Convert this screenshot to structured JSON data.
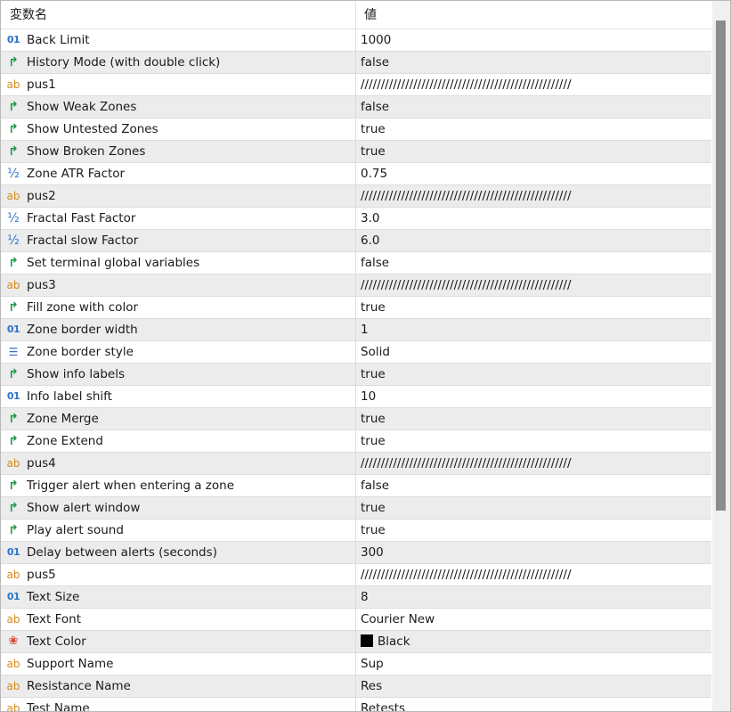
{
  "header": {
    "name_label": "変数名",
    "value_label": "値"
  },
  "rows": [
    {
      "icon": "int-icon",
      "glyph": "01",
      "kind": "int",
      "name": "Back Limit",
      "value": "1000"
    },
    {
      "icon": "bool-icon",
      "glyph": "↱",
      "kind": "bool",
      "name": "History Mode (with double click)",
      "value": "false"
    },
    {
      "icon": "string-icon",
      "glyph": "ab",
      "kind": "str",
      "name": "pus1",
      "value": "////////////////////////////////////////////////////"
    },
    {
      "icon": "bool-icon",
      "glyph": "↱",
      "kind": "bool",
      "name": "Show Weak Zones",
      "value": "false"
    },
    {
      "icon": "bool-icon",
      "glyph": "↱",
      "kind": "bool",
      "name": "Show Untested Zones",
      "value": "true"
    },
    {
      "icon": "bool-icon",
      "glyph": "↱",
      "kind": "bool",
      "name": "Show Broken Zones",
      "value": "true"
    },
    {
      "icon": "double-icon",
      "glyph": "½",
      "kind": "dbl",
      "name": "Zone ATR Factor",
      "value": "0.75"
    },
    {
      "icon": "string-icon",
      "glyph": "ab",
      "kind": "str",
      "name": "pus2",
      "value": "////////////////////////////////////////////////////"
    },
    {
      "icon": "double-icon",
      "glyph": "½",
      "kind": "dbl",
      "name": "Fractal Fast Factor",
      "value": "3.0"
    },
    {
      "icon": "double-icon",
      "glyph": "½",
      "kind": "dbl",
      "name": "Fractal slow Factor",
      "value": "6.0"
    },
    {
      "icon": "bool-icon",
      "glyph": "↱",
      "kind": "bool",
      "name": "Set terminal global variables",
      "value": "false"
    },
    {
      "icon": "string-icon",
      "glyph": "ab",
      "kind": "str",
      "name": "pus3",
      "value": "////////////////////////////////////////////////////"
    },
    {
      "icon": "bool-icon",
      "glyph": "↱",
      "kind": "bool",
      "name": "Fill zone with color",
      "value": "true"
    },
    {
      "icon": "int-icon",
      "glyph": "01",
      "kind": "int",
      "name": "Zone border width",
      "value": "1"
    },
    {
      "icon": "enum-icon",
      "glyph": "☰",
      "kind": "enum",
      "name": "Zone border style",
      "value": "Solid"
    },
    {
      "icon": "bool-icon",
      "glyph": "↱",
      "kind": "bool",
      "name": "Show info labels",
      "value": "true"
    },
    {
      "icon": "int-icon",
      "glyph": "01",
      "kind": "int",
      "name": "Info label shift",
      "value": "10"
    },
    {
      "icon": "bool-icon",
      "glyph": "↱",
      "kind": "bool",
      "name": "Zone Merge",
      "value": "true"
    },
    {
      "icon": "bool-icon",
      "glyph": "↱",
      "kind": "bool",
      "name": "Zone Extend",
      "value": "true"
    },
    {
      "icon": "string-icon",
      "glyph": "ab",
      "kind": "str",
      "name": "pus4",
      "value": "////////////////////////////////////////////////////"
    },
    {
      "icon": "bool-icon",
      "glyph": "↱",
      "kind": "bool",
      "name": "Trigger alert when entering a zone",
      "value": "false"
    },
    {
      "icon": "bool-icon",
      "glyph": "↱",
      "kind": "bool",
      "name": "Show alert window",
      "value": "true"
    },
    {
      "icon": "bool-icon",
      "glyph": "↱",
      "kind": "bool",
      "name": "Play alert sound",
      "value": "true"
    },
    {
      "icon": "int-icon",
      "glyph": "01",
      "kind": "int",
      "name": "Delay between alerts (seconds)",
      "value": "300"
    },
    {
      "icon": "string-icon",
      "glyph": "ab",
      "kind": "str",
      "name": "pus5",
      "value": "////////////////////////////////////////////////////"
    },
    {
      "icon": "int-icon",
      "glyph": "01",
      "kind": "int",
      "name": "Text Size",
      "value": "8"
    },
    {
      "icon": "string-icon",
      "glyph": "ab",
      "kind": "str",
      "name": "Text Font",
      "value": "Courier New"
    },
    {
      "icon": "color-icon",
      "glyph": "❀",
      "kind": "clr",
      "name": "Text Color",
      "value": "Black",
      "swatch": "#000000"
    },
    {
      "icon": "string-icon",
      "glyph": "ab",
      "kind": "str",
      "name": "Support Name",
      "value": "Sup"
    },
    {
      "icon": "string-icon",
      "glyph": "ab",
      "kind": "str",
      "name": "Resistance Name",
      "value": "Res"
    },
    {
      "icon": "string-icon",
      "glyph": "ab",
      "kind": "str",
      "name": "Test Name",
      "value": "Retests"
    }
  ]
}
